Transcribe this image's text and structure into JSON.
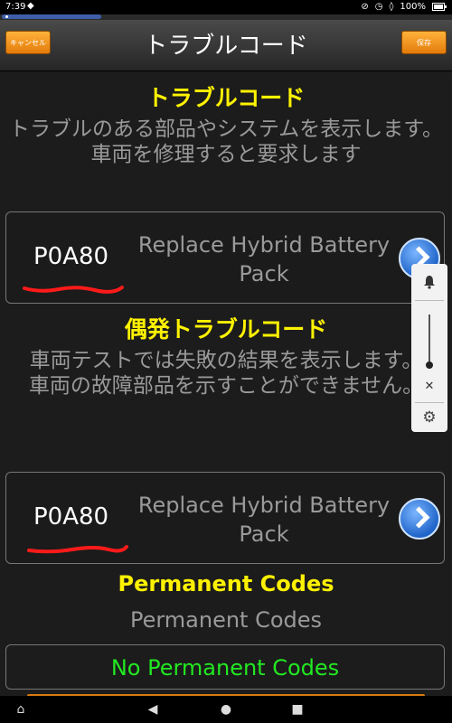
{
  "status_bar": {
    "time": "7:39",
    "incognito_icon": "incognito-icon",
    "battery": "100%"
  },
  "header": {
    "title": "トラブルコード",
    "cancel_label": "キャンセル",
    "save_label": "保存"
  },
  "trouble_codes": {
    "title": "トラブルコード",
    "description": "トラブルのある部品やシステムを表示します。\n車両を修理すると要求します",
    "item": {
      "code": "P0A80",
      "description": "Replace Hybrid Battery Pack"
    }
  },
  "pending_codes": {
    "title": "偶発トラブルコード",
    "description": "車両テストでは失敗の結果を表示します。\n車両の故障部品を示すことができません。",
    "item": {
      "code": "P0A80",
      "description": "Replace Hybrid Battery Pack"
    }
  },
  "permanent_codes": {
    "title": "Permanent Codes",
    "subtitle": "Permanent Codes",
    "empty_label": "No Permanent Codes"
  },
  "colors": {
    "section_title": "#fff200",
    "accent_orange": "#e37b0a",
    "no_codes_green": "#22e822",
    "annotation_red": "#ff1a1a"
  }
}
